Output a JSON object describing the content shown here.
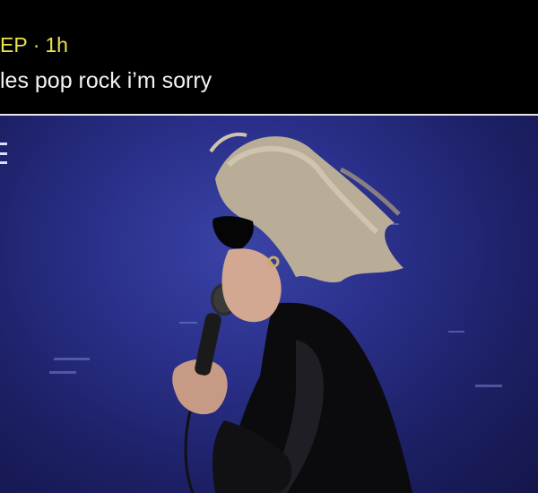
{
  "post": {
    "author_fragment": "EP",
    "separator": "·",
    "time": "1h",
    "caption": "les pop rock i’m sorry"
  },
  "media": {
    "kind": "video-still",
    "subject": "performer-with-microphone"
  },
  "colors": {
    "meta_text": "#e8e34a",
    "caption_text": "#f2f2f2",
    "header_bg": "#000000",
    "stage_blue": "#2a308a"
  }
}
